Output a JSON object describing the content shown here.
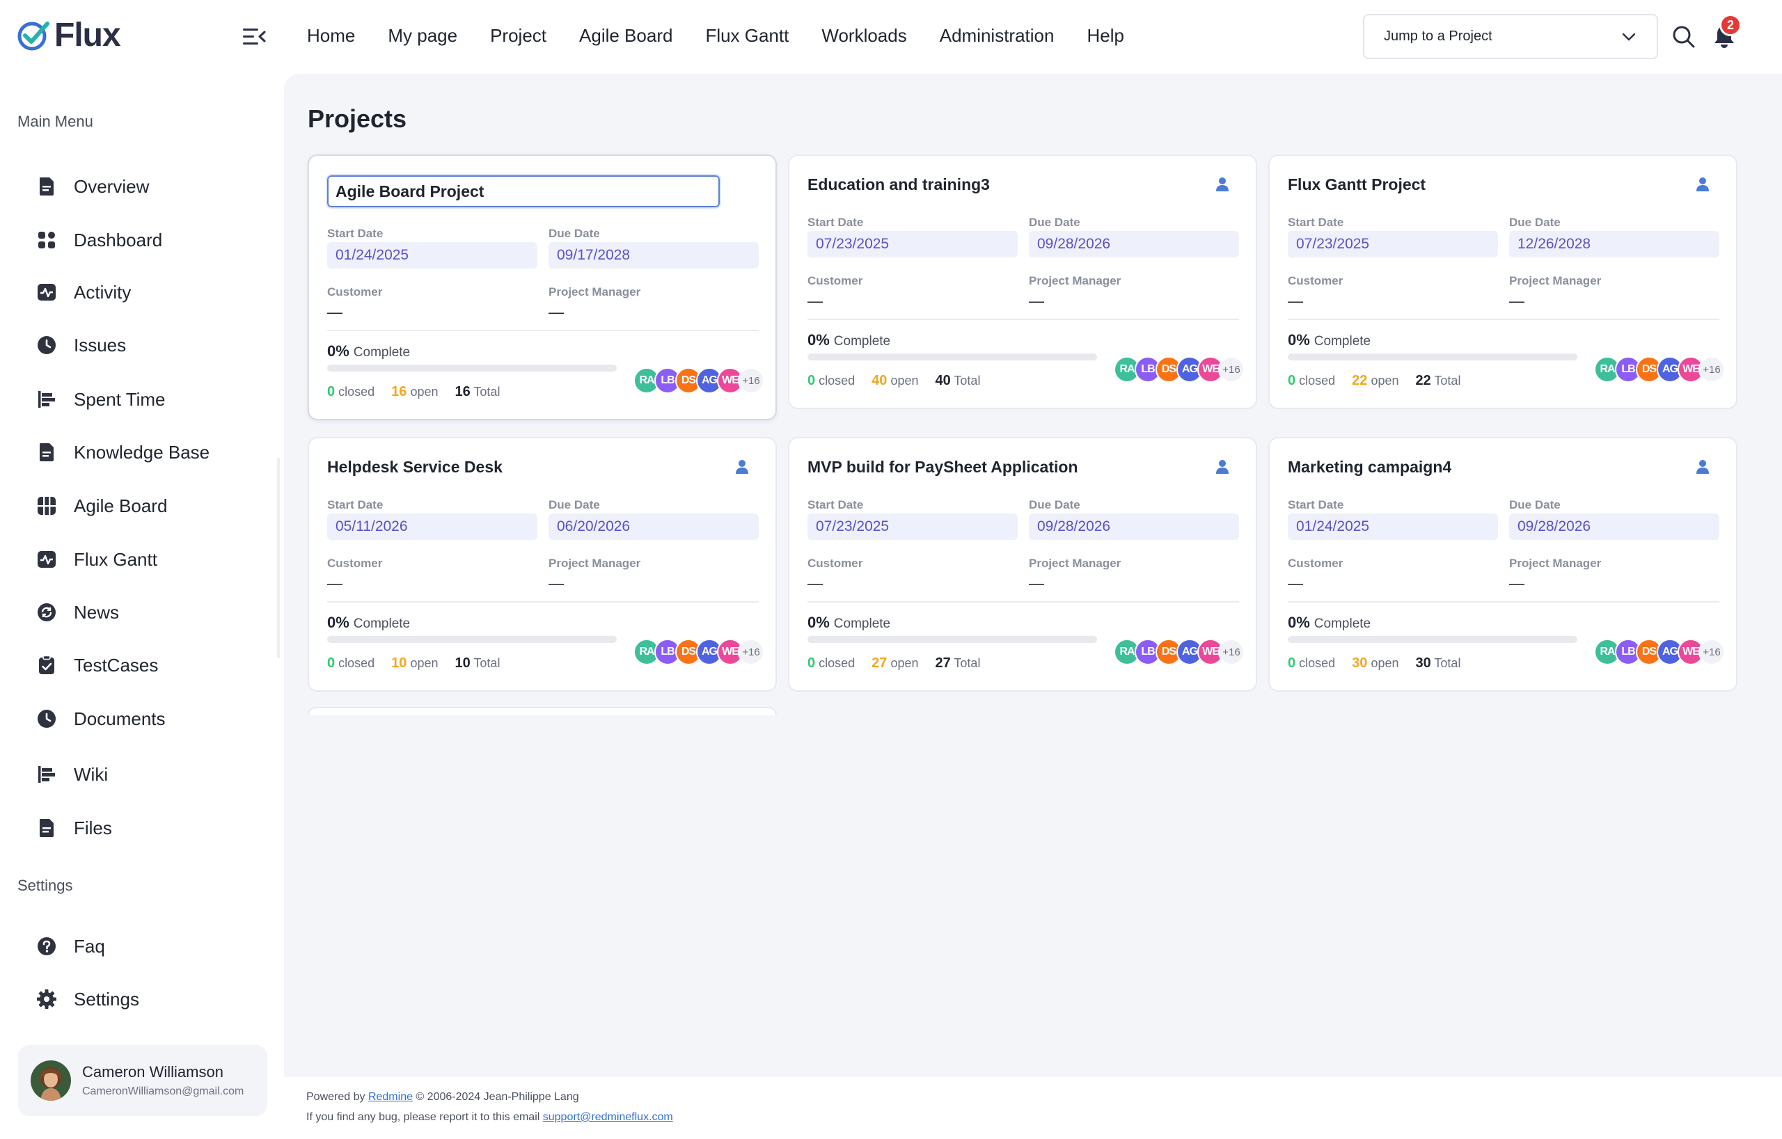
{
  "brand": {
    "name": "Flux",
    "accent": "#23b4a6",
    "check_color": "#3a6fd8"
  },
  "nav": {
    "items": [
      "Home",
      "My page",
      "Project",
      "Agile Board",
      "Flux Gantt",
      "Workloads",
      "Administration",
      "Help"
    ]
  },
  "header": {
    "jump_label": "Jump to a Project",
    "notification_count": "2"
  },
  "sidebar": {
    "main_menu_label": "Main Menu",
    "items": [
      {
        "label": "Overview",
        "icon": "document-icon"
      },
      {
        "label": "Dashboard",
        "icon": "grid-icon"
      },
      {
        "label": "Activity",
        "icon": "pulse-icon"
      },
      {
        "label": "Issues",
        "icon": "clock-icon"
      },
      {
        "label": "Spent Time",
        "icon": "bars-icon"
      },
      {
        "label": "Knowledge Base",
        "icon": "document-icon"
      },
      {
        "label": "Agile Board",
        "icon": "board-icon"
      },
      {
        "label": "Flux Gantt",
        "icon": "pulse-icon"
      },
      {
        "label": "News",
        "icon": "refresh-icon"
      },
      {
        "label": "TestCases",
        "icon": "clipboard-icon"
      },
      {
        "label": "Documents",
        "icon": "clock-icon"
      },
      {
        "label": "Wiki",
        "icon": "bars-icon"
      },
      {
        "label": "Files",
        "icon": "document-icon"
      }
    ],
    "settings_label": "Settings",
    "settings_items": [
      {
        "label": "Faq",
        "icon": "question-icon"
      },
      {
        "label": "Settings",
        "icon": "gear-icon"
      }
    ]
  },
  "user": {
    "name": "Cameron Williamson",
    "email": "CameronWilliamson@gmail.com"
  },
  "main": {
    "title": "Projects",
    "labels": {
      "start_date": "Start Date",
      "due_date": "Due Date",
      "customer": "Customer",
      "project_manager": "Project Manager",
      "complete": "Complete",
      "closed": "closed",
      "open": "open",
      "total": "Total",
      "empty": "—"
    },
    "members": [
      {
        "initials": "RA",
        "color": "#3dbf9a"
      },
      {
        "initials": "LB",
        "color": "#8b5cf6"
      },
      {
        "initials": "DS",
        "color": "#f97316"
      },
      {
        "initials": "AG",
        "color": "#4f63e0"
      },
      {
        "initials": "WE",
        "color": "#ec4899"
      }
    ],
    "members_more": "+16",
    "projects": [
      {
        "name": "Agile Board Project",
        "start": "01/24/2025",
        "due": "09/17/2028",
        "customer": "—",
        "manager": "—",
        "percent": "0%",
        "progress": 0,
        "closed": "0",
        "open": "16",
        "total": "16",
        "editing": true
      },
      {
        "name": "Education and training3",
        "start": "07/23/2025",
        "due": "09/28/2026",
        "customer": "—",
        "manager": "—",
        "percent": "0%",
        "progress": 0,
        "closed": "0",
        "open": "40",
        "total": "40"
      },
      {
        "name": "Flux Gantt Project",
        "start": "07/23/2025",
        "due": "12/26/2028",
        "customer": "—",
        "manager": "—",
        "percent": "0%",
        "progress": 0,
        "closed": "0",
        "open": "22",
        "total": "22"
      },
      {
        "name": "Helpdesk Service Desk",
        "start": "05/11/2026",
        "due": "06/20/2026",
        "customer": "—",
        "manager": "—",
        "percent": "0%",
        "progress": 0,
        "closed": "0",
        "open": "10",
        "total": "10"
      },
      {
        "name": "MVP build for PaySheet Application",
        "start": "07/23/2025",
        "due": "09/28/2026",
        "customer": "—",
        "manager": "—",
        "percent": "0%",
        "progress": 0,
        "closed": "0",
        "open": "27",
        "total": "27"
      },
      {
        "name": "Marketing campaign4",
        "start": "01/24/2025",
        "due": "09/28/2026",
        "customer": "—",
        "manager": "—",
        "percent": "0%",
        "progress": 0,
        "closed": "0",
        "open": "30",
        "total": "30"
      }
    ]
  },
  "footer": {
    "powered_prefix": "Powered by",
    "powered_link": "Redmine",
    "powered_suffix": "© 2006-2024 Jean-Philippe Lang",
    "bug_prefix": "If you find any bug, please report it to this email",
    "bug_email": "support@redmineflux.com"
  }
}
